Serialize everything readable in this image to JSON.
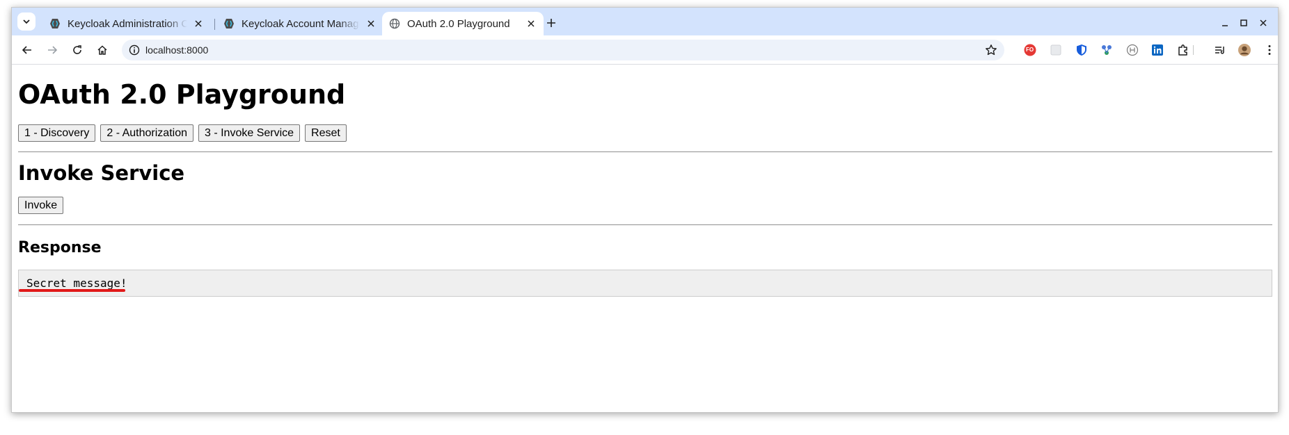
{
  "browser": {
    "tabs": [
      {
        "title": "Keycloak Administration Console",
        "favicon": "keycloak-icon"
      },
      {
        "title": "Keycloak Account Management",
        "favicon": "keycloak-icon"
      },
      {
        "title": "OAuth 2.0 Playground",
        "favicon": "globe-icon"
      }
    ],
    "active_tab_index": 2,
    "url": "localhost:8000",
    "extension_badge": "FO"
  },
  "page": {
    "title": "OAuth 2.0 Playground",
    "steps": [
      "1 - Discovery",
      "2 - Authorization",
      "3 - Invoke Service",
      "Reset"
    ],
    "section_heading": "Invoke Service",
    "invoke_label": "Invoke",
    "response_heading": "Response",
    "response_text": "Secret message!"
  },
  "colors": {
    "tabstrip": "#d3e3fd",
    "omnibox": "#edf2fa",
    "annotation_underline": "#e11919",
    "response_bg": "#efefef"
  }
}
